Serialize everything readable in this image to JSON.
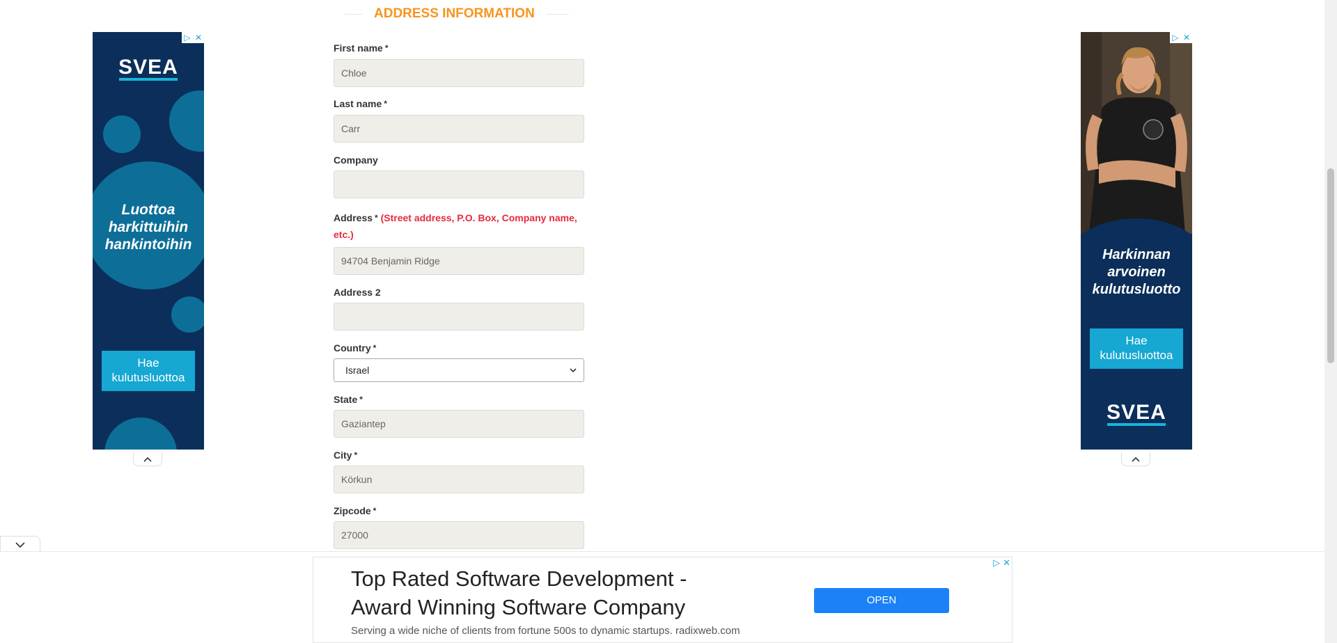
{
  "section": {
    "title": "ADDRESS INFORMATION"
  },
  "form": {
    "required_mark": "*",
    "first_name": {
      "label": "First name",
      "value": "Chloe"
    },
    "last_name": {
      "label": "Last name",
      "value": "Carr"
    },
    "company": {
      "label": "Company",
      "value": ""
    },
    "address": {
      "label": "Address",
      "hint": "(Street address, P.O. Box, Company name, etc.)",
      "value": "94704 Benjamin Ridge"
    },
    "address2": {
      "label": "Address 2",
      "value": ""
    },
    "country": {
      "label": "Country",
      "value": "Israel"
    },
    "state": {
      "label": "State",
      "value": "Gaziantep"
    },
    "city": {
      "label": "City",
      "value": "Körkun"
    },
    "zipcode": {
      "label": "Zipcode",
      "value": "27000"
    }
  },
  "left_ad": {
    "brand": "SVEA",
    "slogan_lines": [
      "Luottoa",
      "harkittuihin",
      "hankintoihin"
    ],
    "button_lines": [
      "Hae",
      "kulutusluottoa"
    ],
    "colors": {
      "background": "#0b2f5a",
      "accent": "#16a7d2"
    }
  },
  "right_ad": {
    "brand": "SVEA",
    "slogan_lines": [
      "Harkinnan",
      "arvoinen",
      "kulutusluotto"
    ],
    "button_lines": [
      "Hae",
      "kulutusluottoa"
    ]
  },
  "bottom_ad": {
    "headline_lines": [
      "Top Rated Software Development -",
      "Award Winning Software Company"
    ],
    "description": "Serving a wide niche of clients from fortune 500s to dynamic startups. radixweb.com",
    "button": "OPEN",
    "button_color": "#1a82f6"
  },
  "colors": {
    "section_title": "#f7941d",
    "hint": "#e8293c",
    "input_bg": "#efeee9"
  }
}
